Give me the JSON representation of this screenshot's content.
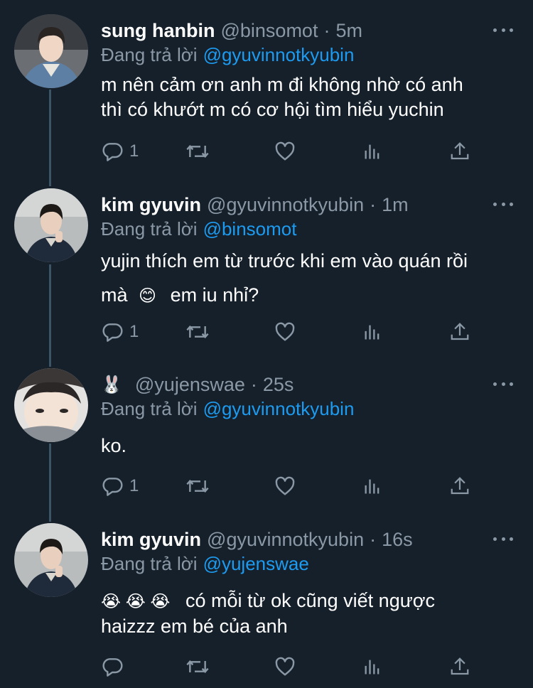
{
  "tweets": [
    {
      "display_name": "sung hanbin",
      "display_emoji": "",
      "handle": "@binsomot",
      "dot": "·",
      "time": "5m",
      "replying_label": "Đang trả lời",
      "replying_to": "@gyuvinnotkyubin",
      "body": {
        "line1": "m nên cảm ơn anh m đi không nhờ có anh",
        "line2": "thì có khướt m có cơ hội tìm hiểu yuchin"
      },
      "actions": {
        "reply_count": "1",
        "retweet_count": "",
        "like_count": ""
      }
    },
    {
      "display_name": "kim gyuvin",
      "display_emoji": "",
      "handle": "@gyuvinnotkyubin",
      "dot": "·",
      "time": "1m",
      "replying_label": "Đang trả lời",
      "replying_to": "@binsomot",
      "body": {
        "line1": "yujin thích em từ trước khi em vào quán rồi",
        "line2_pre": "mà",
        "line2_emoji": "😊",
        "line2_post": "em iu nhỉ?"
      },
      "actions": {
        "reply_count": "1",
        "retweet_count": "",
        "like_count": ""
      }
    },
    {
      "display_name": "",
      "display_emoji": "🐰",
      "handle": "@yujenswae",
      "dot": "·",
      "time": "25s",
      "replying_label": "Đang trả lời",
      "replying_to": "@gyuvinnotkyubin",
      "body": {
        "line1": "ko."
      },
      "actions": {
        "reply_count": "1",
        "retweet_count": "",
        "like_count": ""
      }
    },
    {
      "display_name": "kim gyuvin",
      "display_emoji": "",
      "handle": "@gyuvinnotkyubin",
      "dot": "·",
      "time": "16s",
      "replying_label": "Đang trả lời",
      "replying_to": "@yujenswae",
      "body": {
        "line1_emojis": "😭 😭 😭",
        "line1_text": "có mỗi từ ok cũng viết ngược",
        "line2": "haizzz em bé của anh"
      },
      "actions": {
        "reply_count": "",
        "retweet_count": "",
        "like_count": ""
      }
    }
  ],
  "icons": {
    "reply": "reply-icon",
    "retweet": "retweet-icon",
    "like": "heart-icon",
    "analytics": "analytics-icon",
    "share": "share-icon",
    "more": "more-icon"
  },
  "colors": {
    "background": "#15202b",
    "text_primary": "#ffffff",
    "text_secondary": "#8b98a5",
    "mention": "#1d9bf0",
    "thread_line": "#3d5466"
  }
}
